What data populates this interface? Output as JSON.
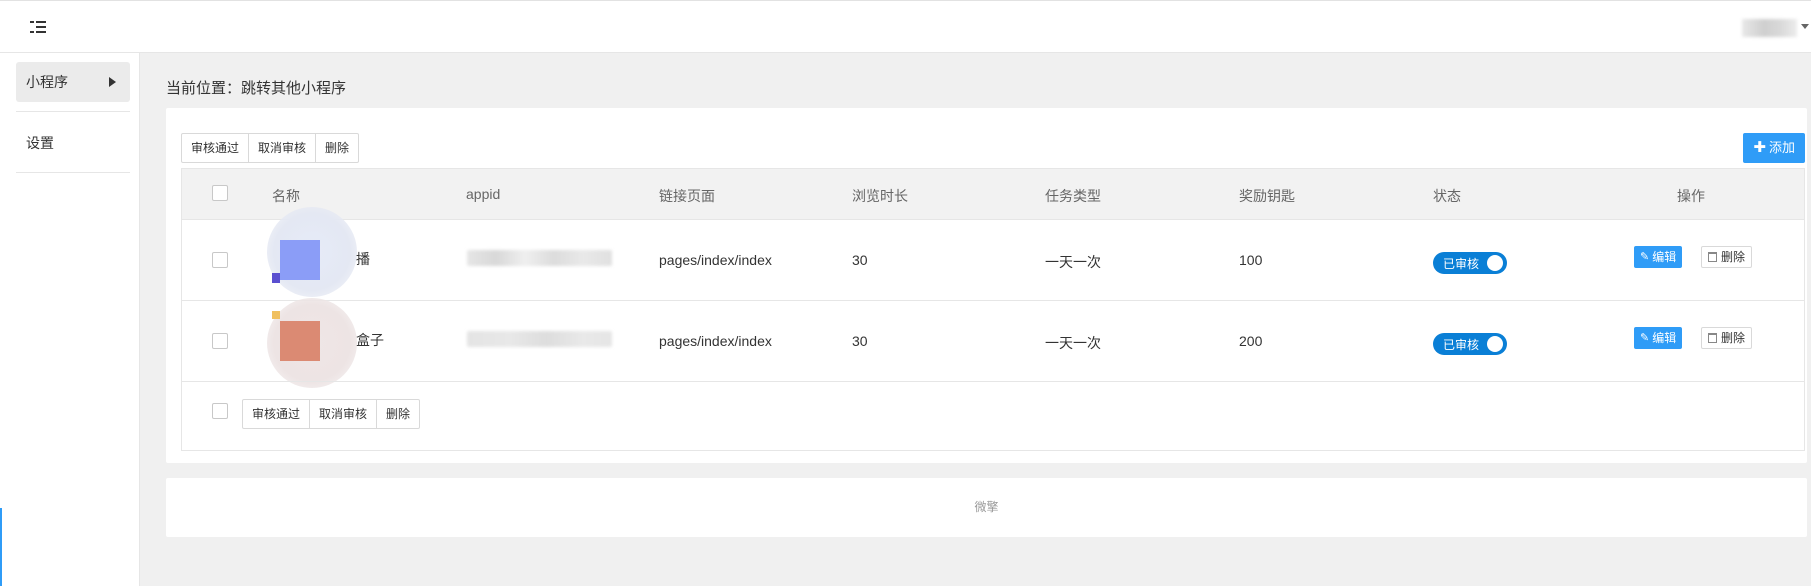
{
  "header": {
    "menu_icon": "menu-fold-icon",
    "user_caret_icon": "caret-down-icon"
  },
  "sidebar": {
    "items": [
      {
        "label": "小程序",
        "active": true,
        "icon": "caret-right-icon"
      },
      {
        "label": "设置",
        "active": false
      }
    ]
  },
  "breadcrumb": {
    "text": "当前位置：跳转其他小程序"
  },
  "toolbar": {
    "approve_label": "审核通过",
    "cancel_label": "取消审核",
    "delete_label": "删除",
    "add_label": "添加",
    "add_icon": "plus-icon"
  },
  "table": {
    "columns": [
      "名称",
      "appid",
      "链接页面",
      "浏览时长",
      "任务类型",
      "奖励钥匙",
      "状态",
      "操作"
    ],
    "rows": [
      {
        "name": "播",
        "page": "pages/index/index",
        "duration": "30",
        "task_type": "一天一次",
        "reward": "100",
        "status": "已审核",
        "edit_label": "编辑",
        "delete_label": "删除"
      },
      {
        "name": "盒子",
        "page": "pages/index/index",
        "duration": "30",
        "task_type": "一天一次",
        "reward": "200",
        "status": "已审核",
        "edit_label": "编辑",
        "delete_label": "删除"
      }
    ]
  },
  "bottom_toolbar": {
    "approve_label": "审核通过",
    "cancel_label": "取消审核",
    "delete_label": "删除"
  },
  "footer": {
    "text": "微擎"
  },
  "colors": {
    "accent": "#2f9cf7",
    "switch_on": "#0a7fd6",
    "background": "#f0f0f0"
  }
}
